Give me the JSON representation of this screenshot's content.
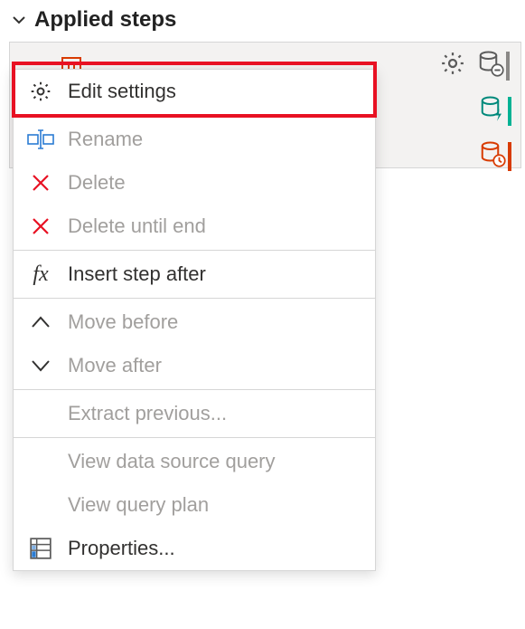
{
  "panel": {
    "title": "Applied steps"
  },
  "menu": {
    "edit_settings": "Edit settings",
    "rename": "Rename",
    "delete": "Delete",
    "delete_until_end": "Delete until end",
    "insert_step_after": "Insert step after",
    "move_before": "Move before",
    "move_after": "Move after",
    "extract_previous": "Extract previous...",
    "view_data_source_query": "View data source query",
    "view_query_plan": "View query plan",
    "properties": "Properties..."
  }
}
